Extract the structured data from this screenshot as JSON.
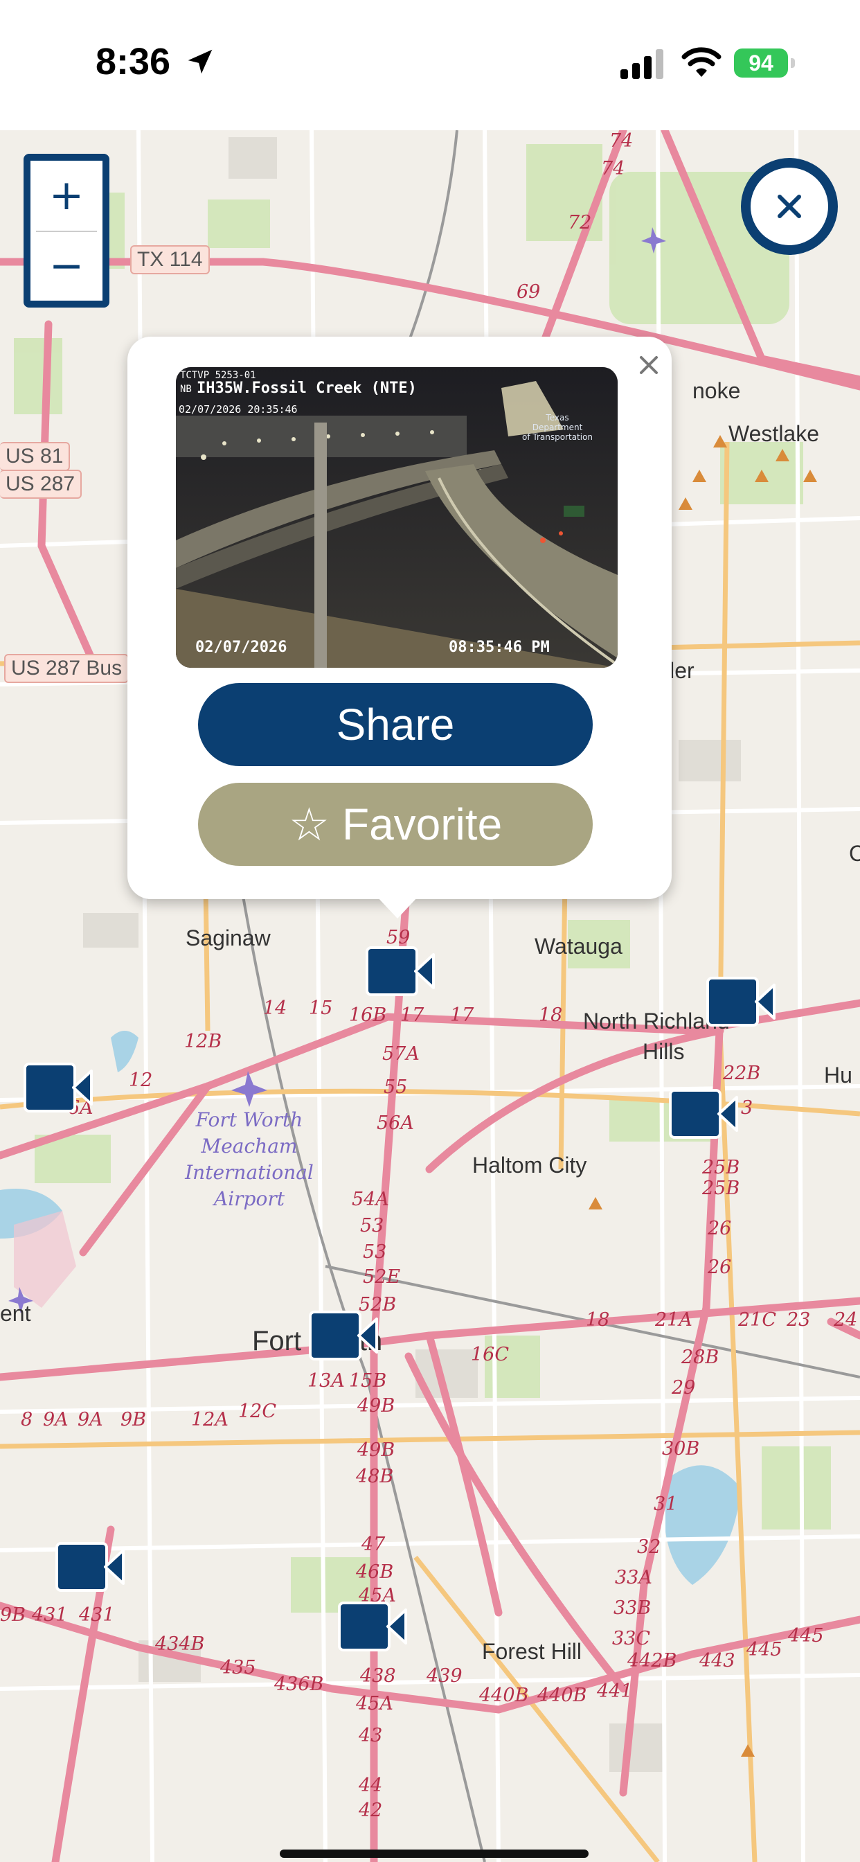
{
  "status_bar": {
    "time": "8:36",
    "battery_percent": "94",
    "battery_color": "#34c759"
  },
  "map": {
    "shields": [
      {
        "key": "tx114",
        "text": "TX 114"
      },
      {
        "key": "us81",
        "text": "US 81"
      },
      {
        "key": "us287",
        "text": "US 287"
      },
      {
        "key": "us287bus",
        "text": "US 287 Bus"
      }
    ],
    "places": [
      "noke",
      "Westlake",
      "ller",
      "Saginaw",
      "Watauga",
      "North Richland",
      "Hills",
      "Hu",
      "C",
      "Haltom City",
      "Fort Worth",
      "ent",
      "Forest Hill"
    ],
    "airport_lines": [
      "Fort Worth",
      "Meacham",
      "International",
      "Airport"
    ],
    "highway_numbers": [
      "74",
      "74",
      "72",
      "69",
      "59",
      "14",
      "15",
      "16B",
      "17",
      "17",
      "18",
      "57A",
      "12B",
      "12",
      "55",
      "56A",
      "6A",
      "54A",
      "53",
      "53",
      "52E",
      "52B",
      "22B",
      "3",
      "25B",
      "25B",
      "26",
      "26",
      "18",
      "21A",
      "21C",
      "23",
      "24",
      "16C",
      "28B",
      "29",
      "13A",
      "15B",
      "49B",
      "8",
      "9A",
      "9A",
      "9B",
      "12A",
      "12C",
      "30B",
      "49B",
      "48B",
      "31",
      "32",
      "47",
      "46B",
      "45A",
      "33A",
      "33B",
      "33C",
      "434B",
      "435",
      "436B",
      "438",
      "439",
      "440B",
      "440B",
      "441",
      "442B",
      "443",
      "445",
      "445",
      "9B",
      "431",
      "431",
      "45A",
      "43",
      "44",
      "42"
    ],
    "marker_icon": "video-camera-icon",
    "accent_color": "#0b3f72"
  },
  "controls": {
    "zoom_in": "+",
    "zoom_out": "−",
    "close_icon": "close-icon"
  },
  "popup": {
    "camera_overlay_id": "TCTVP 5253-01",
    "camera_overlay_line2": "NB",
    "camera_title": "IH35W.Fossil Creek (NTE)",
    "camera_timestamp_top": "02/07/2026 20:35:46",
    "camera_date": "02/07/2026",
    "camera_time": "08:35:46 PM",
    "watermark_line1": "Texas",
    "watermark_line2": "Department",
    "watermark_line3": "of Transportation",
    "share_label": "Share",
    "favorite_star": "☆",
    "favorite_label": "Favorite",
    "share_color": "#0b3f72",
    "favorite_color": "#a9a582"
  }
}
